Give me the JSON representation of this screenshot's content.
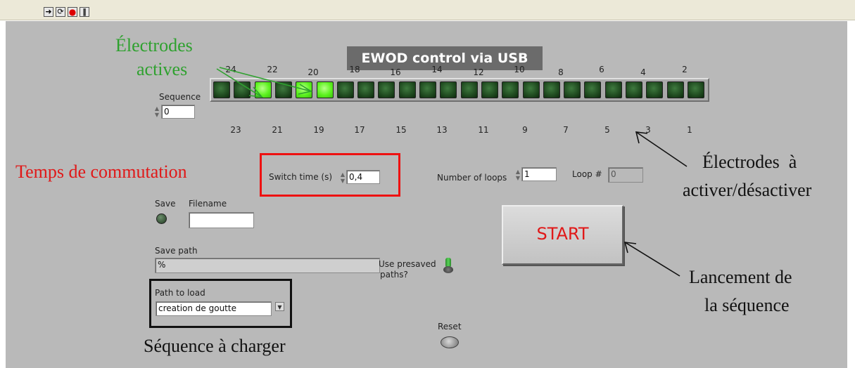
{
  "toolbar": {
    "buttons": [
      {
        "name": "run-arrow-icon",
        "glyph": "➜"
      },
      {
        "name": "run-continuously-icon",
        "glyph": "⟳"
      },
      {
        "name": "abort-icon",
        "glyph": "●"
      },
      {
        "name": "pause-icon",
        "glyph": "‖"
      }
    ]
  },
  "title": "EWOD control via USB",
  "sequence": {
    "label": "Sequence",
    "value": "0"
  },
  "electrodes": {
    "top_labels": [
      "24",
      "22",
      "20",
      "18",
      "16",
      "14",
      "12",
      "10",
      "8",
      "6",
      "4",
      "2"
    ],
    "bottom_labels": [
      "23",
      "21",
      "19",
      "17",
      "15",
      "13",
      "11",
      "9",
      "7",
      "5",
      "3",
      "1"
    ],
    "states": [
      false,
      false,
      true,
      false,
      true,
      true,
      false,
      false,
      false,
      false,
      false,
      false,
      false,
      false,
      false,
      false,
      false,
      false,
      false,
      false,
      false,
      false,
      false,
      false
    ],
    "on_color": "#5cf21e",
    "off_color": "#1f4a1f"
  },
  "switch_time": {
    "label": "Switch time (s)",
    "value": "0,4"
  },
  "loops": {
    "label": "Number of loops",
    "value": "1"
  },
  "loop_index": {
    "label": "Loop #",
    "value": "0"
  },
  "save": {
    "label": "Save"
  },
  "filename": {
    "label": "Filename",
    "value": ""
  },
  "save_path": {
    "label": "Save path",
    "value": "%"
  },
  "presaved": {
    "label_line1": "Use presaved",
    "label_line2": "paths?"
  },
  "path_to_load": {
    "label": "Path to load",
    "value": "creation de goutte"
  },
  "start": {
    "label": "START"
  },
  "reset": {
    "label": "Reset"
  },
  "annotations": {
    "active_electrodes": [
      "Électrodes",
      "actives"
    ],
    "switch_time": "Temps de commutation",
    "electrodes_toggle": [
      "Électrodes  à",
      "activer/désactiver"
    ],
    "launch": [
      "Lancement de",
      "la séquence"
    ],
    "sequence_load": "Séquence à charger"
  },
  "colors": {
    "panel": "#b9b9b9",
    "annotation_green": "#2fa12f",
    "annotation_red": "#e01818",
    "highlight_red": "#ee1111",
    "start_text": "#e01818"
  }
}
